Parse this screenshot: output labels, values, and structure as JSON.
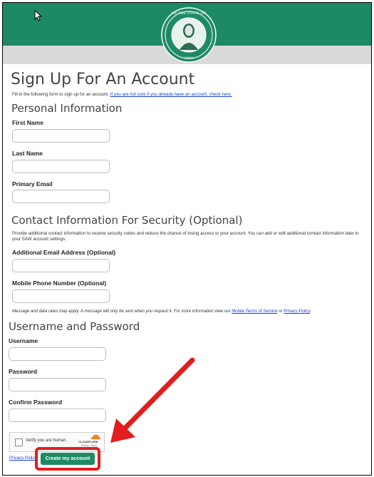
{
  "header": {
    "seal": {
      "logo_text": "THE SEAL OF THE STATE OF WASHINGTON",
      "year": "1889"
    }
  },
  "page": {
    "title": "Sign Up For An Account",
    "intro": "Fill in the following form to sign up for an account.",
    "intro_link": "If you are not sure if you already have an account, check here."
  },
  "personal": {
    "heading": "Personal Information",
    "first_name_label": "First Name",
    "last_name_label": "Last Name",
    "email_label": "Primary Email"
  },
  "contact": {
    "heading": "Contact Information For Security (Optional)",
    "desc_line1": "Provide additional contact information to receive security codes and reduce the chance of losing access to your account. You can add or edit additional contact information later in",
    "desc_line2": "your SAW account settings.",
    "alt_email_label": "Additional Email Address (Optional)",
    "phone_label": "Mobile Phone Number (Optional)",
    "rates_note": "Message and data rates may apply. A message will only be sent when you request it. For more information view our",
    "terms_link": "Mobile Terms of Service",
    "or_text": "or",
    "privacy_link": "Privacy Policy",
    "period": "."
  },
  "credentials": {
    "heading": "Username and Password",
    "username_label": "Username",
    "password_label": "Password",
    "confirm_label": "Confirm Password"
  },
  "captcha": {
    "label": "Verify you are human",
    "brand": "CLOUDFLARE",
    "brand_sub": "Privacy · Terms"
  },
  "footer": {
    "privacy_link": "Privacy Policy",
    "submit_label": "Create my account"
  },
  "colors": {
    "brand_green": "#1d8a63",
    "annotation_red": "#e31d1d"
  }
}
